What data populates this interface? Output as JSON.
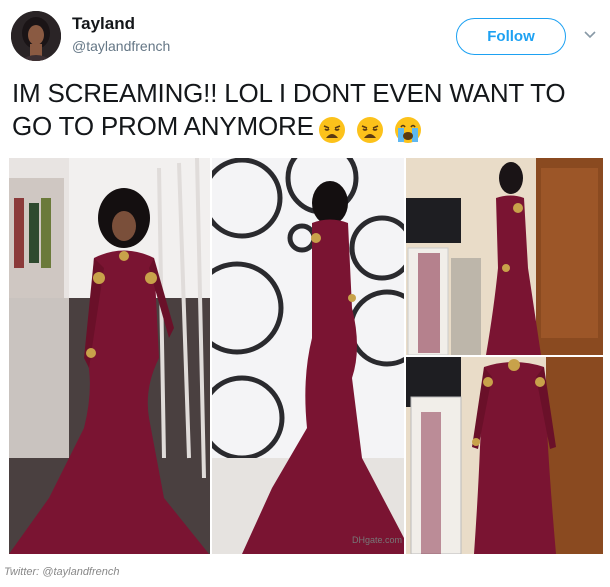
{
  "user": {
    "display_name": "Tayland",
    "handle": "@taylandfrench",
    "avatar_icon": "profile-photo"
  },
  "follow_button": {
    "label": "Follow"
  },
  "menu": {
    "icon": "chevron-down-icon"
  },
  "tweet": {
    "text": "IM SCREAMING!! LOL I DONT EVEN WANT TO GO TO PROM ANYMORE",
    "emojis": [
      "weary-face",
      "weary-face",
      "loudly-crying-face"
    ]
  },
  "media": {
    "photos": [
      {
        "name": "photo-red-dress-model"
      },
      {
        "name": "photo-dress-catalog-back"
      },
      {
        "name": "photo-dress-mirror-side"
      },
      {
        "name": "photo-dress-mirror-front"
      }
    ],
    "watermark": "DHgate.com"
  },
  "credit": {
    "text": "Twitter: @taylandfrench"
  },
  "colors": {
    "accent": "#1da1f2",
    "dress": "#7a1432",
    "text": "#14171a",
    "muted": "#657786"
  }
}
